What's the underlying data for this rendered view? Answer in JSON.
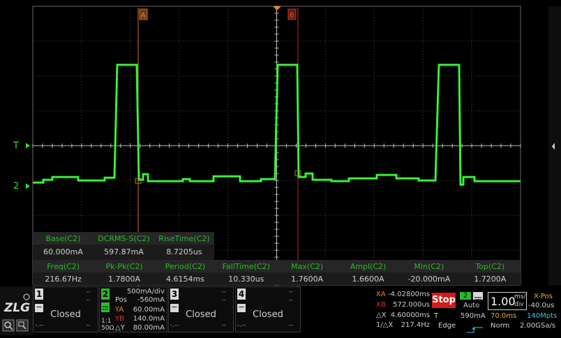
{
  "trigger": {
    "level_marker": "T",
    "channel_marker": "2"
  },
  "cursors": {
    "a_label": "A",
    "b_label": "B"
  },
  "measurements_row1": [
    {
      "label": "Base(C2)",
      "value": "60.000mA"
    },
    {
      "label": "DCRMS-S(C2)",
      "value": "597.87mA"
    },
    {
      "label": "RiseTime(C2)",
      "value": "8.7205us"
    }
  ],
  "measurements_row2": [
    {
      "label": "Freq(C2)",
      "value": "216.67Hz"
    },
    {
      "label": "Pk-Pk(C2)",
      "value": "1.7800A"
    },
    {
      "label": "Period(C2)",
      "value": "4.6154ms"
    },
    {
      "label": "FallTime(C2)",
      "value": "10.330us"
    },
    {
      "label": "Max(C2)",
      "value": "1.7600A"
    },
    {
      "label": "Ampl(C2)",
      "value": "1.6600A"
    },
    {
      "label": "Min(C2)",
      "value": "-20.000mA"
    },
    {
      "label": "Top(C2)",
      "value": "1.7200A"
    }
  ],
  "channels": {
    "ch1": {
      "number": "1",
      "status": "Closed",
      "dash1": "--",
      "dash2": "--",
      "dash3": "-.--",
      "dash4": "--"
    },
    "ch2": {
      "number": "2",
      "scale": "500mA/div",
      "pos_label": "Pos",
      "pos_value": "-560mA",
      "ya_label": "YA",
      "ya_value": "60.00mA",
      "yb_label": "YB",
      "yb_value": "140.0mA",
      "dy_label": "△Y",
      "dy_value": "80.00mA",
      "coupling": "1:1",
      "impedance": "50Ω"
    },
    "ch3": {
      "number": "3",
      "status": "Closed",
      "dash1": "--",
      "dash2": "--",
      "dash3": "-.--",
      "dash4": "--"
    },
    "ch4": {
      "number": "4",
      "status": "Closed",
      "dash1": "--",
      "dash2": "--",
      "dash3": "-.--",
      "dash4": "--"
    }
  },
  "cursor_readout": {
    "xa_label": "XA",
    "xa_value": "-4.02800ms",
    "xb_label": "XB",
    "xb_value": "572.000us",
    "dx_label": "△X",
    "dx_value": "4.60000ms",
    "inv_label": "1/△X",
    "inv_value": "217.4Hz"
  },
  "trigger_panel": {
    "run_state": "Stop",
    "source": "2",
    "mode": "Auto",
    "t_label": "T",
    "level": "590mA",
    "type": "Edge"
  },
  "timebase": {
    "value": "1.00",
    "unit_top": "ms/",
    "unit_bottom": "div",
    "xpos_label": "X-Pos",
    "xpos_value": "-40.0us",
    "delay": "70.0ms",
    "memory": "140Mpts",
    "acq_mode": "Norm",
    "sample_rate": "2.00GSa/s"
  },
  "colors": {
    "waveform": "#1fe81f",
    "cursor_a": "#e4882a",
    "cursor_b": "#d23c2a",
    "trigger_marker": "#e8851f",
    "measure_label": "#2db82d"
  }
}
